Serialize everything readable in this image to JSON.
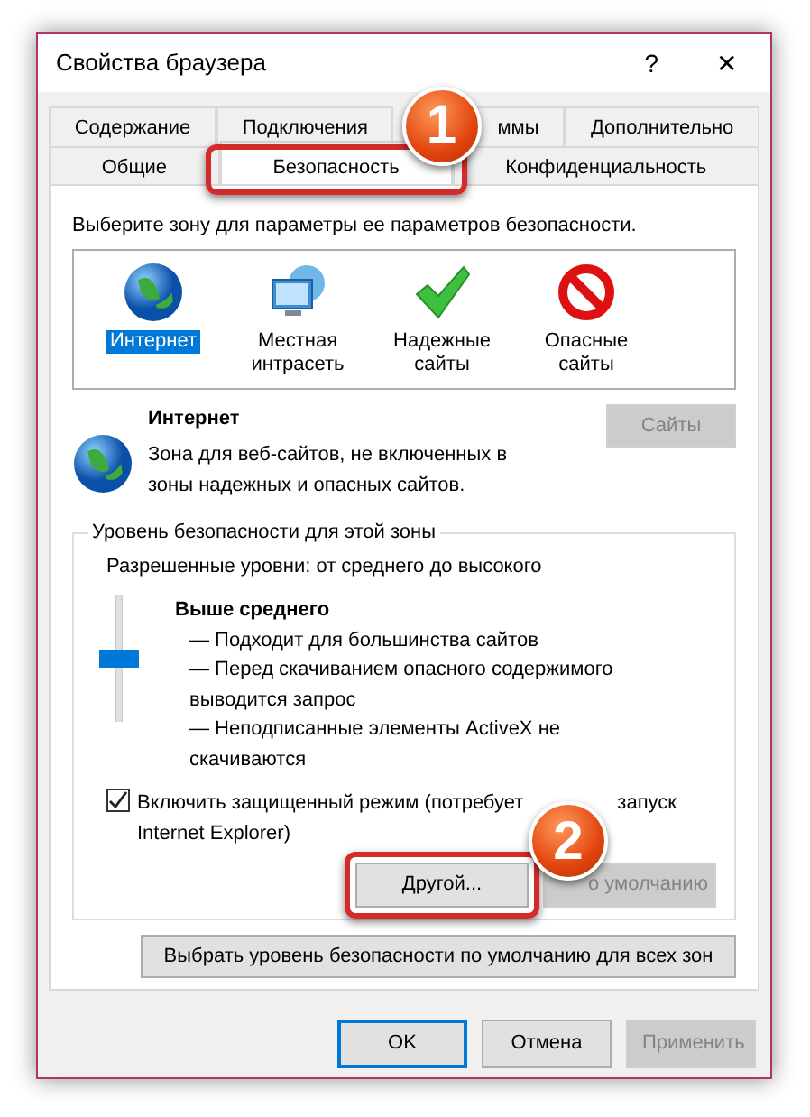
{
  "window": {
    "title": "Свойства браузера",
    "help": "?",
    "close": "✕"
  },
  "tabs_row_1": [
    {
      "label": "Содержание",
      "selected": false
    },
    {
      "label": "Подключения",
      "selected": false
    },
    {
      "label": "ммы",
      "selected": false
    },
    {
      "label": "Дополнительно",
      "selected": false
    }
  ],
  "tabs_row_2": [
    {
      "label": "Общие",
      "selected": false
    },
    {
      "label": "Безопасность",
      "selected": true
    },
    {
      "label": "Конфиденциальность",
      "selected": false
    }
  ],
  "zone_prompt": "Выберите зону для параметры ее параметров безопасности.",
  "zones": [
    {
      "kind": "globe",
      "label": "Интернет",
      "selected": true
    },
    {
      "kind": "intranet",
      "label": "Местная интрасеть",
      "selected": false
    },
    {
      "kind": "trusted",
      "label": "Надежные сайты",
      "selected": false
    },
    {
      "kind": "restricted",
      "label": "Опасные сайты",
      "selected": false
    }
  ],
  "zone_info": {
    "title": "Интернет",
    "description": "Зона для веб-сайтов, не включенных в зоны надежных и опасных сайтов.",
    "sites_button": {
      "label": "Сайты",
      "disabled": true
    }
  },
  "security_level": {
    "legend": "Уровень безопасности для этой зоны",
    "allowed": "Разрешенные уровни: от среднего до высокого",
    "level": 0.5,
    "level_name": "Выше среднего",
    "details": [
      "— Подходит для большинства сайтов",
      "— Перед скачиванием опасного содержимого выводится запрос",
      "— Неподписанные элементы ActiveX не скачиваются"
    ],
    "protected_mode": {
      "checked": true,
      "label_start": "Включить защищенный режим (потребует",
      "label_end": "запуск",
      "label_line_2": "Internet Explorer)"
    },
    "buttons": [
      {
        "label": "Другой...",
        "disabled": false
      },
      {
        "label": "о умолчанию",
        "disabled": true
      }
    ]
  },
  "reset_all_button": "Выбрать уровень безопасности по умолчанию для всех зон",
  "footer_buttons": [
    {
      "label": "OK",
      "default": true,
      "disabled": false
    },
    {
      "label": "Отмена",
      "default": false,
      "disabled": false
    },
    {
      "label": "Применить",
      "default": false,
      "disabled": true
    }
  ],
  "annotations": [
    "1",
    "2"
  ]
}
